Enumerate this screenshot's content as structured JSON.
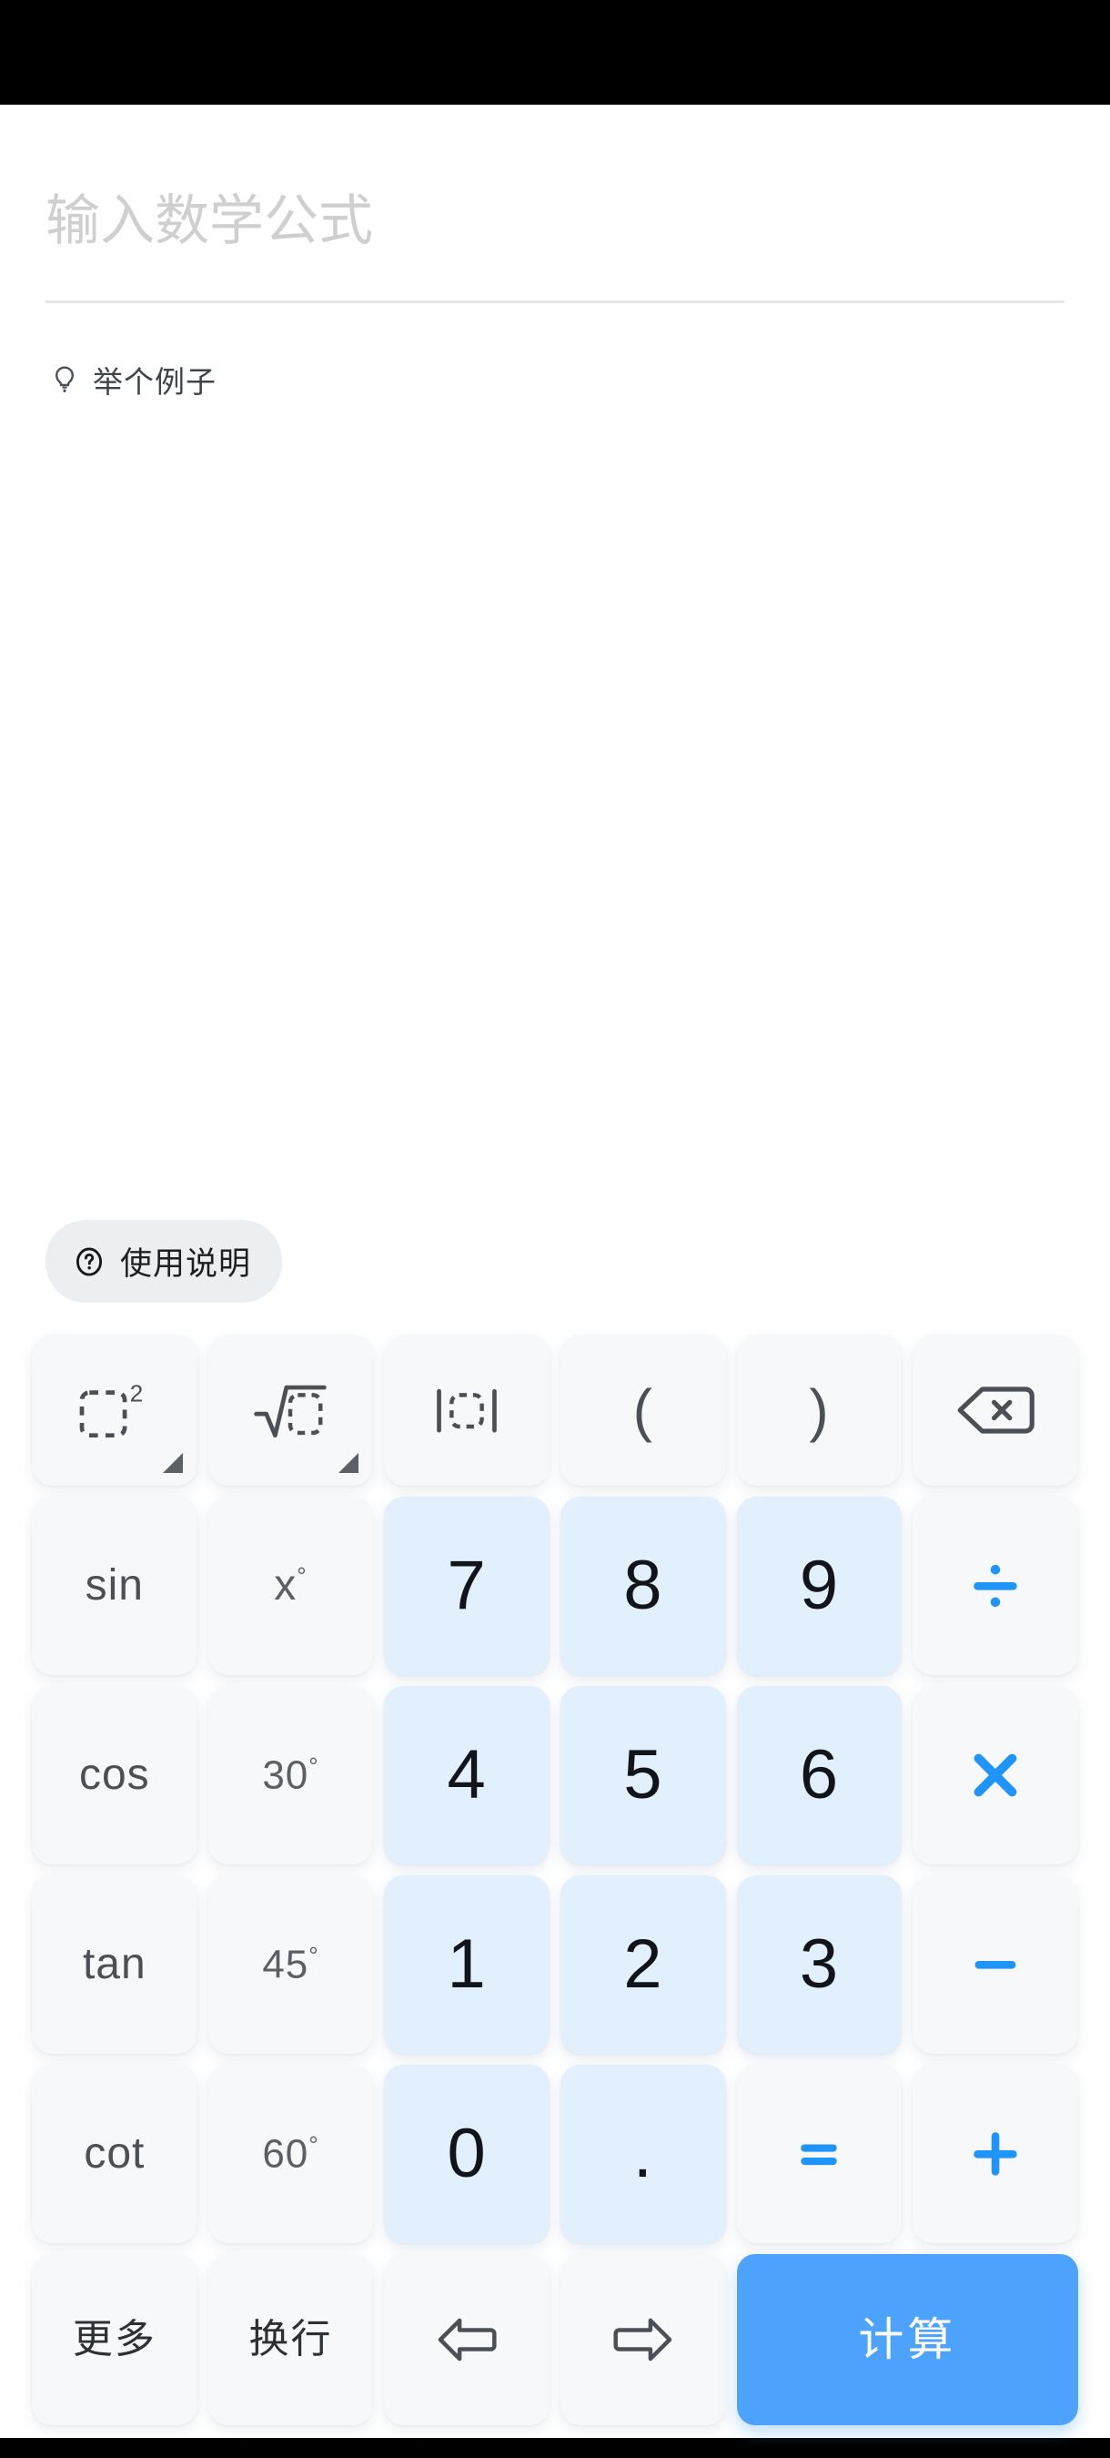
{
  "app": {
    "accent_color": "#4da2fb",
    "number_key_color": "#e2effd",
    "function_key_color": "#f6f8fa",
    "status_bar_color": "#000000"
  },
  "input": {
    "placeholder": "输入数学公式",
    "value": ""
  },
  "hint": {
    "icon": "lightbulb-icon",
    "label": "举个例子"
  },
  "usage": {
    "icon": "question-circle-icon",
    "label": "使用说明"
  },
  "keypad": {
    "rows": [
      {
        "name": "row-functions",
        "keys": [
          {
            "name": "power-key",
            "label": "",
            "icon": "box-squared-icon",
            "type": "func",
            "long_press": true
          },
          {
            "name": "sqrt-key",
            "label": "",
            "icon": "square-root-icon",
            "type": "func",
            "long_press": true
          },
          {
            "name": "absolute-key",
            "label": "",
            "icon": "absolute-value-icon",
            "type": "func",
            "long_press": false
          },
          {
            "name": "open-paren-key",
            "label": "(",
            "icon": "",
            "type": "paren",
            "long_press": false
          },
          {
            "name": "close-paren-key",
            "label": ")",
            "icon": "",
            "type": "paren",
            "long_press": false
          },
          {
            "name": "backspace-key",
            "label": "",
            "icon": "backspace-icon",
            "type": "func",
            "long_press": false
          }
        ]
      },
      {
        "name": "row-789",
        "keys": [
          {
            "name": "sin-key",
            "label": "sin",
            "icon": "",
            "type": "func",
            "long_press": false
          },
          {
            "name": "x-degree-key",
            "label": "x",
            "icon": "degree-sup",
            "type": "xdeg",
            "long_press": false
          },
          {
            "name": "digit-7-key",
            "label": "7",
            "icon": "",
            "type": "num",
            "long_press": false
          },
          {
            "name": "digit-8-key",
            "label": "8",
            "icon": "",
            "type": "num",
            "long_press": false
          },
          {
            "name": "digit-9-key",
            "label": "9",
            "icon": "",
            "type": "num",
            "long_press": false
          },
          {
            "name": "divide-key",
            "label": "",
            "icon": "divide-icon",
            "type": "op",
            "long_press": false
          }
        ]
      },
      {
        "name": "row-456",
        "keys": [
          {
            "name": "cos-key",
            "label": "cos",
            "icon": "",
            "type": "func",
            "long_press": false
          },
          {
            "name": "deg-30-key",
            "label": "30",
            "icon": "degree-sup",
            "type": "deg",
            "long_press": false
          },
          {
            "name": "digit-4-key",
            "label": "4",
            "icon": "",
            "type": "num",
            "long_press": false
          },
          {
            "name": "digit-5-key",
            "label": "5",
            "icon": "",
            "type": "num",
            "long_press": false
          },
          {
            "name": "digit-6-key",
            "label": "6",
            "icon": "",
            "type": "num",
            "long_press": false
          },
          {
            "name": "multiply-key",
            "label": "",
            "icon": "multiply-icon",
            "type": "op",
            "long_press": false
          }
        ]
      },
      {
        "name": "row-123",
        "keys": [
          {
            "name": "tan-key",
            "label": "tan",
            "icon": "",
            "type": "func",
            "long_press": false
          },
          {
            "name": "deg-45-key",
            "label": "45",
            "icon": "degree-sup",
            "type": "deg",
            "long_press": false
          },
          {
            "name": "digit-1-key",
            "label": "1",
            "icon": "",
            "type": "num",
            "long_press": false
          },
          {
            "name": "digit-2-key",
            "label": "2",
            "icon": "",
            "type": "num",
            "long_press": false
          },
          {
            "name": "digit-3-key",
            "label": "3",
            "icon": "",
            "type": "num",
            "long_press": false
          },
          {
            "name": "minus-key",
            "label": "",
            "icon": "minus-icon",
            "type": "op",
            "long_press": false
          }
        ]
      },
      {
        "name": "row-0-dot",
        "keys": [
          {
            "name": "cot-key",
            "label": "cot",
            "icon": "",
            "type": "func",
            "long_press": false
          },
          {
            "name": "deg-60-key",
            "label": "60",
            "icon": "degree-sup",
            "type": "deg",
            "long_press": false
          },
          {
            "name": "digit-0-key",
            "label": "0",
            "icon": "",
            "type": "num",
            "long_press": false
          },
          {
            "name": "decimal-key",
            "label": ".",
            "icon": "",
            "type": "dot",
            "long_press": false
          },
          {
            "name": "equals-key",
            "label": "",
            "icon": "equals-icon",
            "type": "op",
            "long_press": false
          },
          {
            "name": "plus-key",
            "label": "",
            "icon": "plus-icon",
            "type": "op",
            "long_press": false
          }
        ]
      },
      {
        "name": "row-actions",
        "keys": [
          {
            "name": "more-key",
            "label": "更多",
            "icon": "",
            "type": "cjk",
            "long_press": false
          },
          {
            "name": "newline-key",
            "label": "换行",
            "icon": "",
            "type": "cjk",
            "long_press": false
          },
          {
            "name": "cursor-left-key",
            "label": "",
            "icon": "arrow-left-icon",
            "type": "func",
            "long_press": false
          },
          {
            "name": "cursor-right-key",
            "label": "",
            "icon": "arrow-right-icon",
            "type": "func",
            "long_press": false
          },
          {
            "name": "calculate-key",
            "label": "计算",
            "icon": "",
            "type": "primary",
            "long_press": false,
            "span": 2
          }
        ]
      }
    ]
  }
}
